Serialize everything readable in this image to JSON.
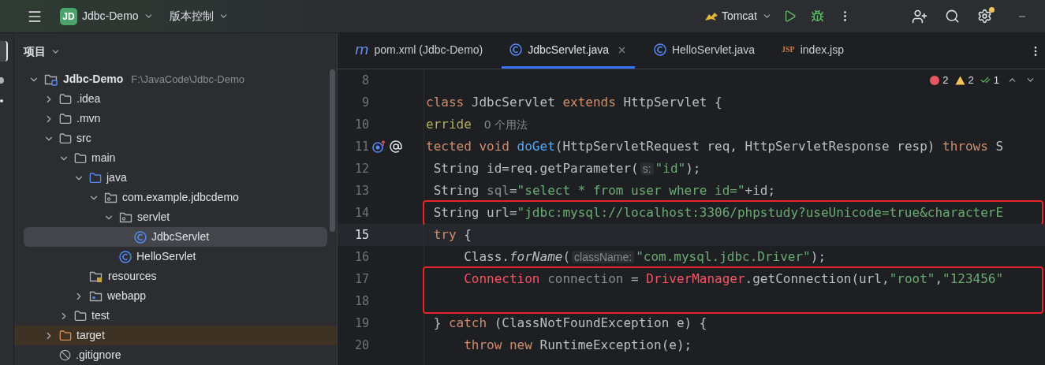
{
  "topbar": {
    "project": {
      "badge": "JD",
      "name": "Jdbc-Demo"
    },
    "vcs": "版本控制",
    "run_config": "Tomcat",
    "settings_notification": true
  },
  "sidebar": {
    "title": "项目",
    "tree": [
      {
        "name": "Jdbc-Demo",
        "path": "F:\\JavaCode\\Jdbc-Demo",
        "kind": "project",
        "expanded": true,
        "selected": false,
        "children": [
          {
            "name": ".idea",
            "kind": "folder",
            "expanded": false,
            "selected": false
          },
          {
            "name": ".mvn",
            "kind": "folder",
            "expanded": false,
            "selected": false
          },
          {
            "name": "src",
            "kind": "folder",
            "expanded": true,
            "selected": false,
            "children": [
              {
                "name": "main",
                "kind": "folder",
                "expanded": true,
                "selected": false,
                "children": [
                  {
                    "name": "java",
                    "kind": "source",
                    "expanded": true,
                    "selected": false,
                    "children": [
                      {
                        "name": "com.example.jdbcdemo",
                        "kind": "package",
                        "expanded": true,
                        "selected": false,
                        "children": [
                          {
                            "name": "servlet",
                            "kind": "package",
                            "expanded": true,
                            "selected": false,
                            "children": [
                              {
                                "name": "JdbcServlet",
                                "kind": "class",
                                "selected": true
                              }
                            ]
                          },
                          {
                            "name": "HelloServlet",
                            "kind": "class",
                            "selected": false
                          }
                        ]
                      }
                    ]
                  },
                  {
                    "name": "resources",
                    "kind": "resources",
                    "selected": false
                  },
                  {
                    "name": "webapp",
                    "kind": "web",
                    "expanded": false,
                    "selected": false
                  }
                ]
              },
              {
                "name": "test",
                "kind": "folder",
                "expanded": false,
                "selected": false
              }
            ]
          },
          {
            "name": "target",
            "kind": "excluded",
            "expanded": false,
            "selected": false
          },
          {
            "name": ".gitignore",
            "kind": "ignore",
            "selected": false
          }
        ]
      }
    ]
  },
  "editor": {
    "tabs": [
      {
        "label": "pom.xml (Jdbc-Demo)",
        "kind": "maven",
        "icon_text": "m",
        "selected": false,
        "closable": false
      },
      {
        "label": "JdbcServlet.java",
        "kind": "class",
        "selected": true,
        "closable": true
      },
      {
        "label": "HelloServlet.java",
        "kind": "class",
        "selected": false,
        "closable": false
      },
      {
        "label": "index.jsp",
        "kind": "jsp",
        "icon_text": "JSP",
        "selected": false,
        "closable": false
      }
    ],
    "inspections": {
      "errors": "2",
      "warnings": "2",
      "typos": "1"
    },
    "lines": [
      {
        "number": "8",
        "current": false,
        "boxed": false
      },
      {
        "number": "9",
        "current": false,
        "boxed": false,
        "segments": [
          {
            "kind": "kw",
            "t": "class "
          },
          {
            "kind": "plain",
            "t": "JdbcServlet "
          },
          {
            "kind": "kw",
            "t": "extends "
          },
          {
            "kind": "plain",
            "t": "HttpServlet {"
          }
        ]
      },
      {
        "number": "10",
        "current": false,
        "boxed": false,
        "segments": [
          {
            "kind": "ann",
            "t": "erride"
          },
          {
            "kind": "usage",
            "t": "0 个用法"
          }
        ]
      },
      {
        "number": "11",
        "current": false,
        "boxed": false,
        "gutter_icons": [
          {
            "kind": "override"
          },
          {
            "kind": "annotation"
          }
        ],
        "segments": [
          {
            "kind": "kw",
            "t": "tected void "
          },
          {
            "kind": "fn",
            "t": "doGet"
          },
          {
            "kind": "plain",
            "t": "(HttpServletRequest req, HttpServletResponse resp) "
          },
          {
            "kind": "kw",
            "t": "throws "
          },
          {
            "kind": "plain",
            "t": "S"
          }
        ]
      },
      {
        "number": "12",
        "current": false,
        "boxed": false,
        "segments": [
          {
            "kind": "plain",
            "t": " String id=req.getParameter("
          },
          {
            "kind": "hint",
            "t": "s:"
          },
          {
            "kind": "str",
            "t": "\"id\""
          },
          {
            "kind": "plain",
            "t": ");"
          }
        ]
      },
      {
        "number": "13",
        "current": false,
        "boxed": false,
        "segments": [
          {
            "kind": "plain",
            "t": " String "
          },
          {
            "kind": "unused",
            "t": "sql"
          },
          {
            "kind": "plain",
            "t": "="
          },
          {
            "kind": "str",
            "t": "\"select * from user where id=\""
          },
          {
            "kind": "plain",
            "t": "+id;"
          }
        ]
      },
      {
        "number": "14",
        "current": false,
        "boxed": true,
        "segments": [
          {
            "kind": "plain",
            "t": " String url="
          },
          {
            "kind": "str",
            "t": "\"jdbc:mysql://localhost:3306/phpstudy?useUnicode=true&characterE"
          }
        ]
      },
      {
        "number": "15",
        "current": true,
        "boxed": false,
        "segments": [
          {
            "kind": "kw",
            "t": " try "
          },
          {
            "kind": "plain",
            "t": "{"
          }
        ]
      },
      {
        "number": "16",
        "current": false,
        "boxed": false,
        "segments": [
          {
            "kind": "plain",
            "t": "     Class."
          },
          {
            "kind": "italic",
            "t": "forName"
          },
          {
            "kind": "plain",
            "t": "("
          },
          {
            "kind": "hint",
            "t": "className:"
          },
          {
            "kind": "str",
            "t": "\"com.mysql.jdbc.Driver\""
          },
          {
            "kind": "plain",
            "t": ");"
          }
        ]
      },
      {
        "number": "17",
        "current": false,
        "boxed": true,
        "segments": [
          {
            "kind": "err",
            "t": "     Connection "
          },
          {
            "kind": "unused",
            "t": "connection"
          },
          {
            "kind": "plain",
            "t": " = "
          },
          {
            "kind": "err",
            "t": "DriverManager"
          },
          {
            "kind": "plain",
            "t": ".getConnection(url,"
          },
          {
            "kind": "str",
            "t": "\"root\""
          },
          {
            "kind": "plain",
            "t": ","
          },
          {
            "kind": "str",
            "t": "\"123456\""
          }
        ]
      },
      {
        "number": "18",
        "current": false,
        "boxed": true
      },
      {
        "number": "19",
        "current": false,
        "boxed": false,
        "segments": [
          {
            "kind": "plain",
            "t": " } "
          },
          {
            "kind": "kw",
            "t": "catch "
          },
          {
            "kind": "plain",
            "t": "(ClassNotFoundException e) {"
          }
        ]
      },
      {
        "number": "20",
        "current": false,
        "boxed": false,
        "segments": [
          {
            "kind": "kw",
            "t": "     throw new "
          },
          {
            "kind": "plain",
            "t": "RuntimeException(e);"
          }
        ]
      }
    ]
  }
}
